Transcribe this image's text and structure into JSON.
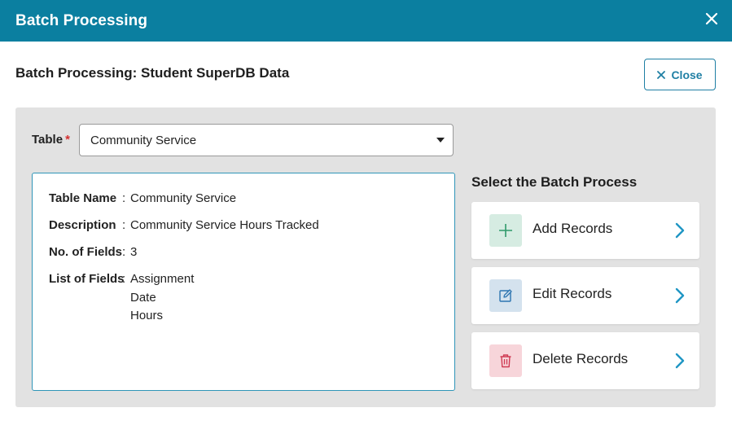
{
  "modal": {
    "title": "Batch Processing",
    "close_icon": "close-icon"
  },
  "subheader": {
    "title": "Batch Processing: Student SuperDB Data",
    "close_label": "Close"
  },
  "table_select": {
    "label": "Table",
    "required_mark": "*",
    "value": "Community Service"
  },
  "info": {
    "rows": [
      {
        "key": "Table Name",
        "colon": ":",
        "value": "Community Service"
      },
      {
        "key": "Description",
        "colon": ":",
        "value": "Community Service Hours Tracked"
      },
      {
        "key": "No. of Fields",
        "colon": ":",
        "value": "3"
      },
      {
        "key": "List of Fields",
        "colon": ":",
        "values": [
          "Assignment",
          "Date",
          "Hours"
        ]
      }
    ]
  },
  "batch": {
    "title": "Select the Batch Process",
    "actions": [
      {
        "label": "Add Records",
        "icon": "plus-icon",
        "icon_bg": "#d6ece2",
        "icon_color": "#2f9a6a"
      },
      {
        "label": "Edit Records",
        "icon": "edit-icon",
        "icon_bg": "#d4e2ee",
        "icon_color": "#2c74b0"
      },
      {
        "label": "Delete Records",
        "icon": "trash-icon",
        "icon_bg": "#f7d5da",
        "icon_color": "#cf3a52"
      }
    ],
    "chevron_color": "#1f96c4"
  },
  "colors": {
    "header_bg": "#0b7fa0",
    "accent": "#1f7fa4",
    "panel_bg": "#e2e2e2"
  }
}
